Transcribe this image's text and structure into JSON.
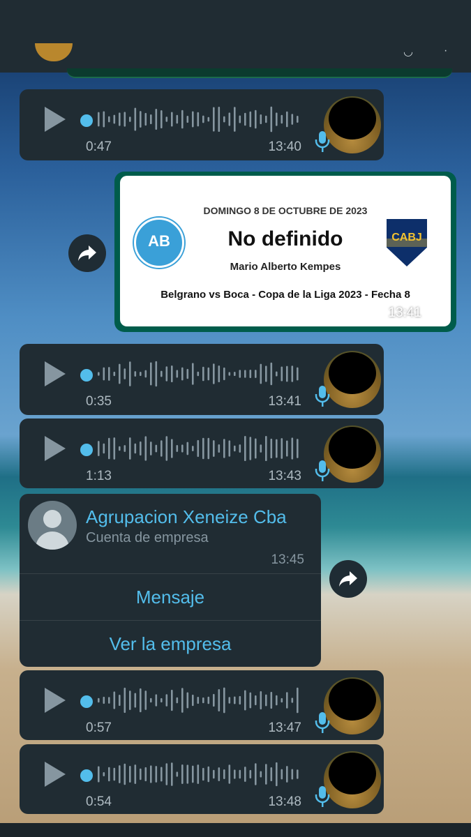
{
  "voice_messages": [
    {
      "duration": "0:47",
      "time": "13:40"
    },
    {
      "duration": "0:35",
      "time": "13:41"
    },
    {
      "duration": "1:13",
      "time": "13:43"
    },
    {
      "duration": "0:57",
      "time": "13:47"
    },
    {
      "duration": "0:54",
      "time": "13:48"
    }
  ],
  "event_card": {
    "date": "DOMINGO 8 DE OCTUBRE DE 2023",
    "status": "No definido",
    "venue": "Mario Alberto Kempes",
    "match": "Belgrano vs Boca - Copa de la Liga 2023 - Fecha 8",
    "time": "13:41",
    "home_crest": "belgrano-crest",
    "away_crest": "boca-crest",
    "away_crest_text": "CABJ",
    "home_crest_text": "AB"
  },
  "contact_card": {
    "name": "Agrupacion Xeneize Cba",
    "subtitle": "Cuenta de empresa",
    "time": "13:45",
    "message_button": "Mensaje",
    "view_business_button": "Ver la empresa"
  },
  "colors": {
    "bubble": "#202c33",
    "outgoing_bubble": "#005c4b",
    "accent": "#53bdeb",
    "secondary_text": "#8696a0"
  },
  "icons": [
    "play-icon",
    "microphone-icon",
    "forward-icon",
    "double-check-icon",
    "default-avatar-icon"
  ]
}
